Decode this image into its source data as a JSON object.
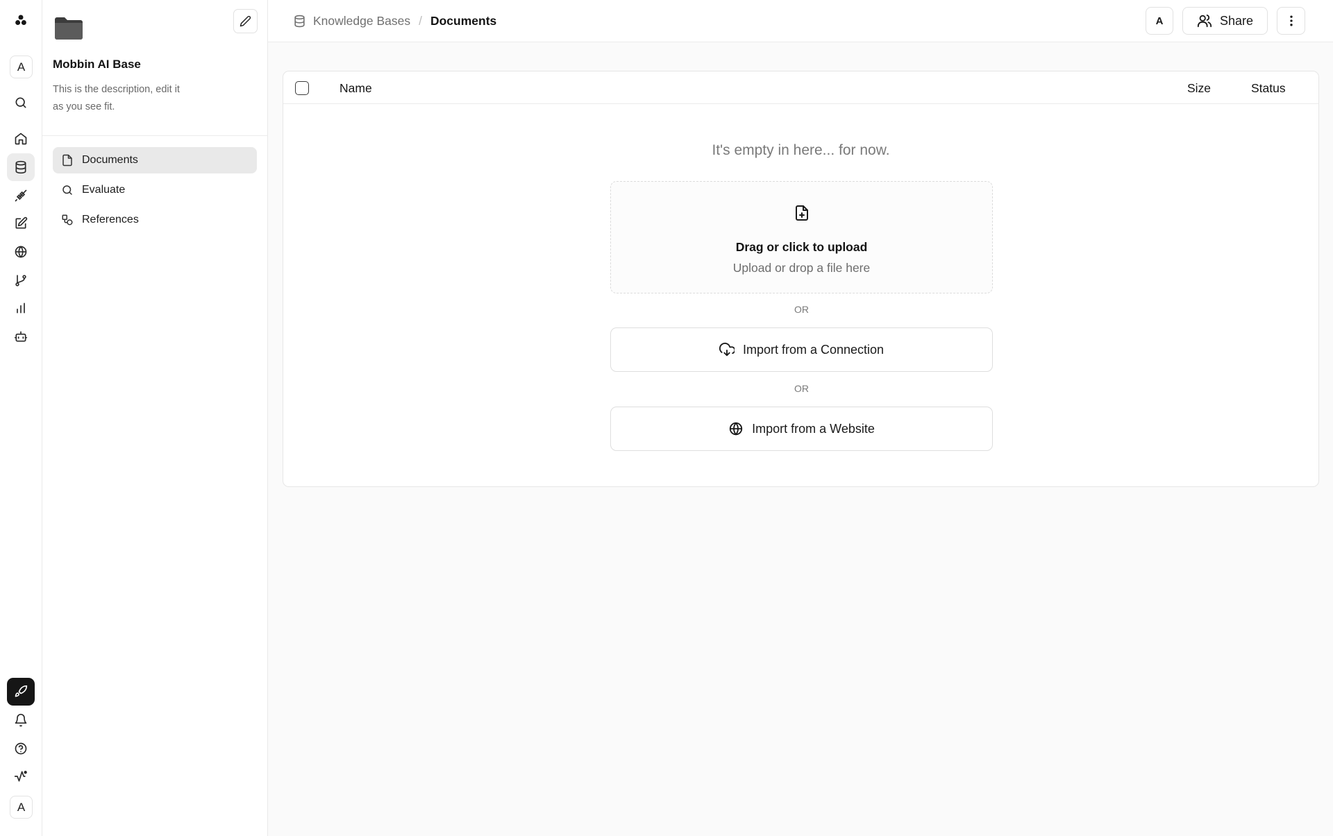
{
  "rail": {
    "top_avatar": "A",
    "bottom_avatar": "A",
    "icons": [
      "app-logo-icon",
      "search-icon",
      "home-icon",
      "database-icon",
      "plug-icon",
      "pencil-square-icon",
      "globe-icon",
      "git-branch-icon",
      "bar-chart-icon",
      "bot-icon",
      "rocket-icon",
      "bell-icon",
      "help-circle-icon",
      "activity-icon"
    ]
  },
  "kb": {
    "title": "Mobbin AI Base",
    "description": "This is the description, edit it as you see fit.",
    "nav": [
      {
        "label": "Documents",
        "icon": "file-icon",
        "active": true
      },
      {
        "label": "Evaluate",
        "icon": "search-icon",
        "active": false
      },
      {
        "label": "References",
        "icon": "shapes-icon",
        "active": false
      }
    ]
  },
  "topbar": {
    "breadcrumb_parent": "Knowledge Bases",
    "breadcrumb_separator": "/",
    "breadcrumb_current": "Documents",
    "avatar": "A",
    "share_label": "Share"
  },
  "table": {
    "columns": {
      "name": "Name",
      "size": "Size",
      "status": "Status"
    },
    "empty_message": "It's empty in here... for now."
  },
  "upload": {
    "title": "Drag or click to upload",
    "subtitle": "Upload or drop a file here",
    "or_label": "OR",
    "import_connection": "Import from a Connection",
    "import_website": "Import from a Website"
  },
  "colors": {
    "background": "#fafafa",
    "panel": "#ffffff",
    "active_nav": "#e9e9e9",
    "launch_button": "#161616"
  }
}
